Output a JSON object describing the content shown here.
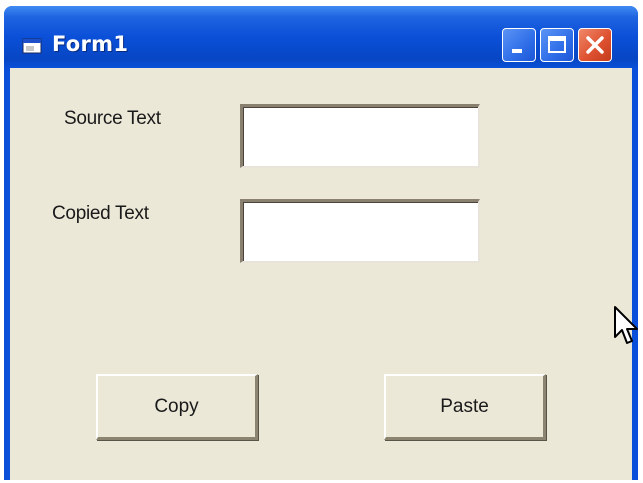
{
  "window": {
    "title": "Form1",
    "controls": {
      "minimize_icon": "minimize-icon",
      "maximize_icon": "maximize-icon",
      "close_icon": "close-icon"
    }
  },
  "form": {
    "source_label": "Source Text",
    "source_value": "",
    "copied_label": "Copied Text",
    "copied_value": "",
    "copy_label": "Copy",
    "paste_label": "Paste"
  },
  "colors": {
    "titlebar": "#0a50d8",
    "client_background": "#ebe8d8",
    "close_button": "#de5231"
  },
  "cursor": "mouse-pointer-icon"
}
